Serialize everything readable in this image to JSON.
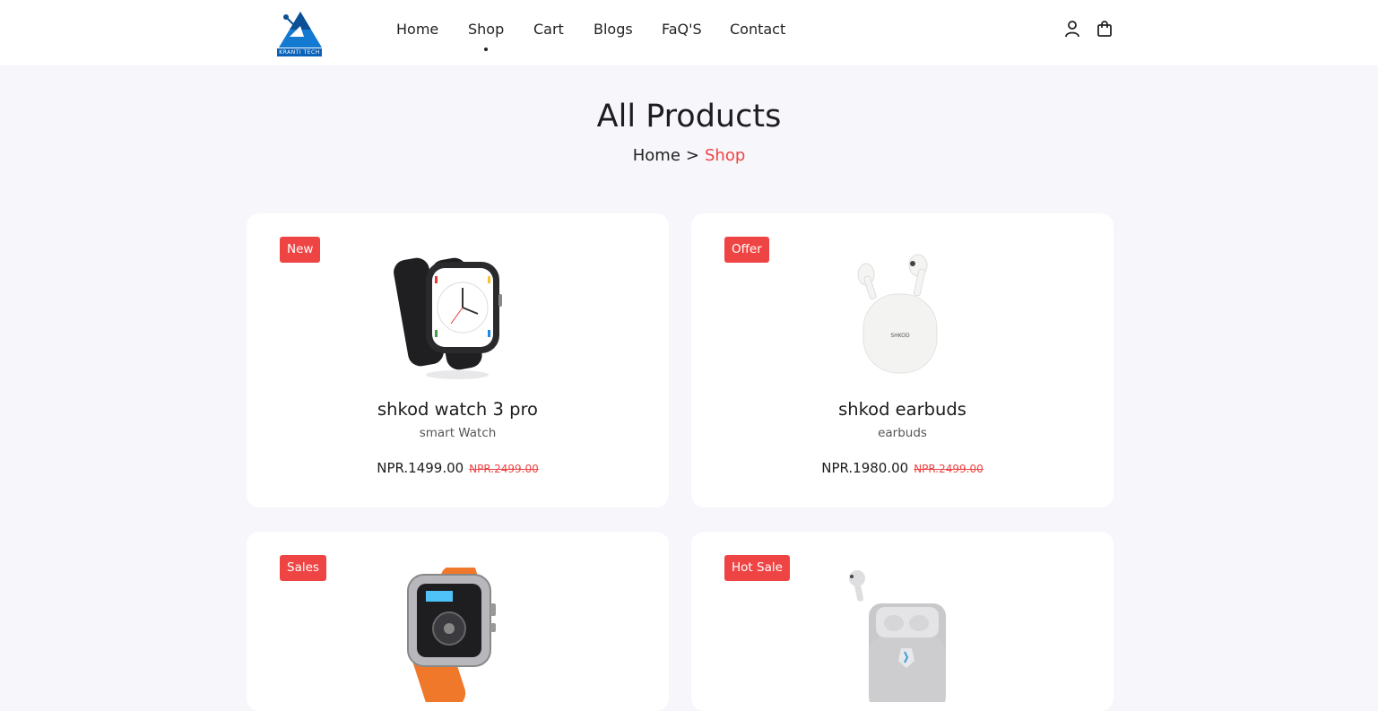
{
  "brand": {
    "logo_text": "KRANTI TECH"
  },
  "nav": [
    {
      "label": "Home"
    },
    {
      "label": "Shop"
    },
    {
      "label": "Cart"
    },
    {
      "label": "Blogs"
    },
    {
      "label": "FaQ'S"
    },
    {
      "label": "Contact"
    }
  ],
  "header_icons": [
    "user-icon",
    "shopping-bag-icon"
  ],
  "page": {
    "title": "All Products",
    "breadcrumb": {
      "home": "Home",
      "separator": ">",
      "current": "Shop"
    }
  },
  "colors": {
    "accent": "#ef4444",
    "background": "#f6f6fb",
    "card": "#ffffff",
    "text": "#1d1d1f"
  },
  "products": [
    {
      "badge": "New",
      "name": "shkod watch 3 pro",
      "category": "smart Watch",
      "price": "NPR.1499.00",
      "old_price": "NPR.2499.00"
    },
    {
      "badge": "Offer",
      "name": "shkod earbuds",
      "category": "earbuds",
      "price": "NPR.1980.00",
      "old_price": "NPR.2499.00"
    },
    {
      "badge": "Sales"
    },
    {
      "badge": "Hot Sale"
    }
  ]
}
